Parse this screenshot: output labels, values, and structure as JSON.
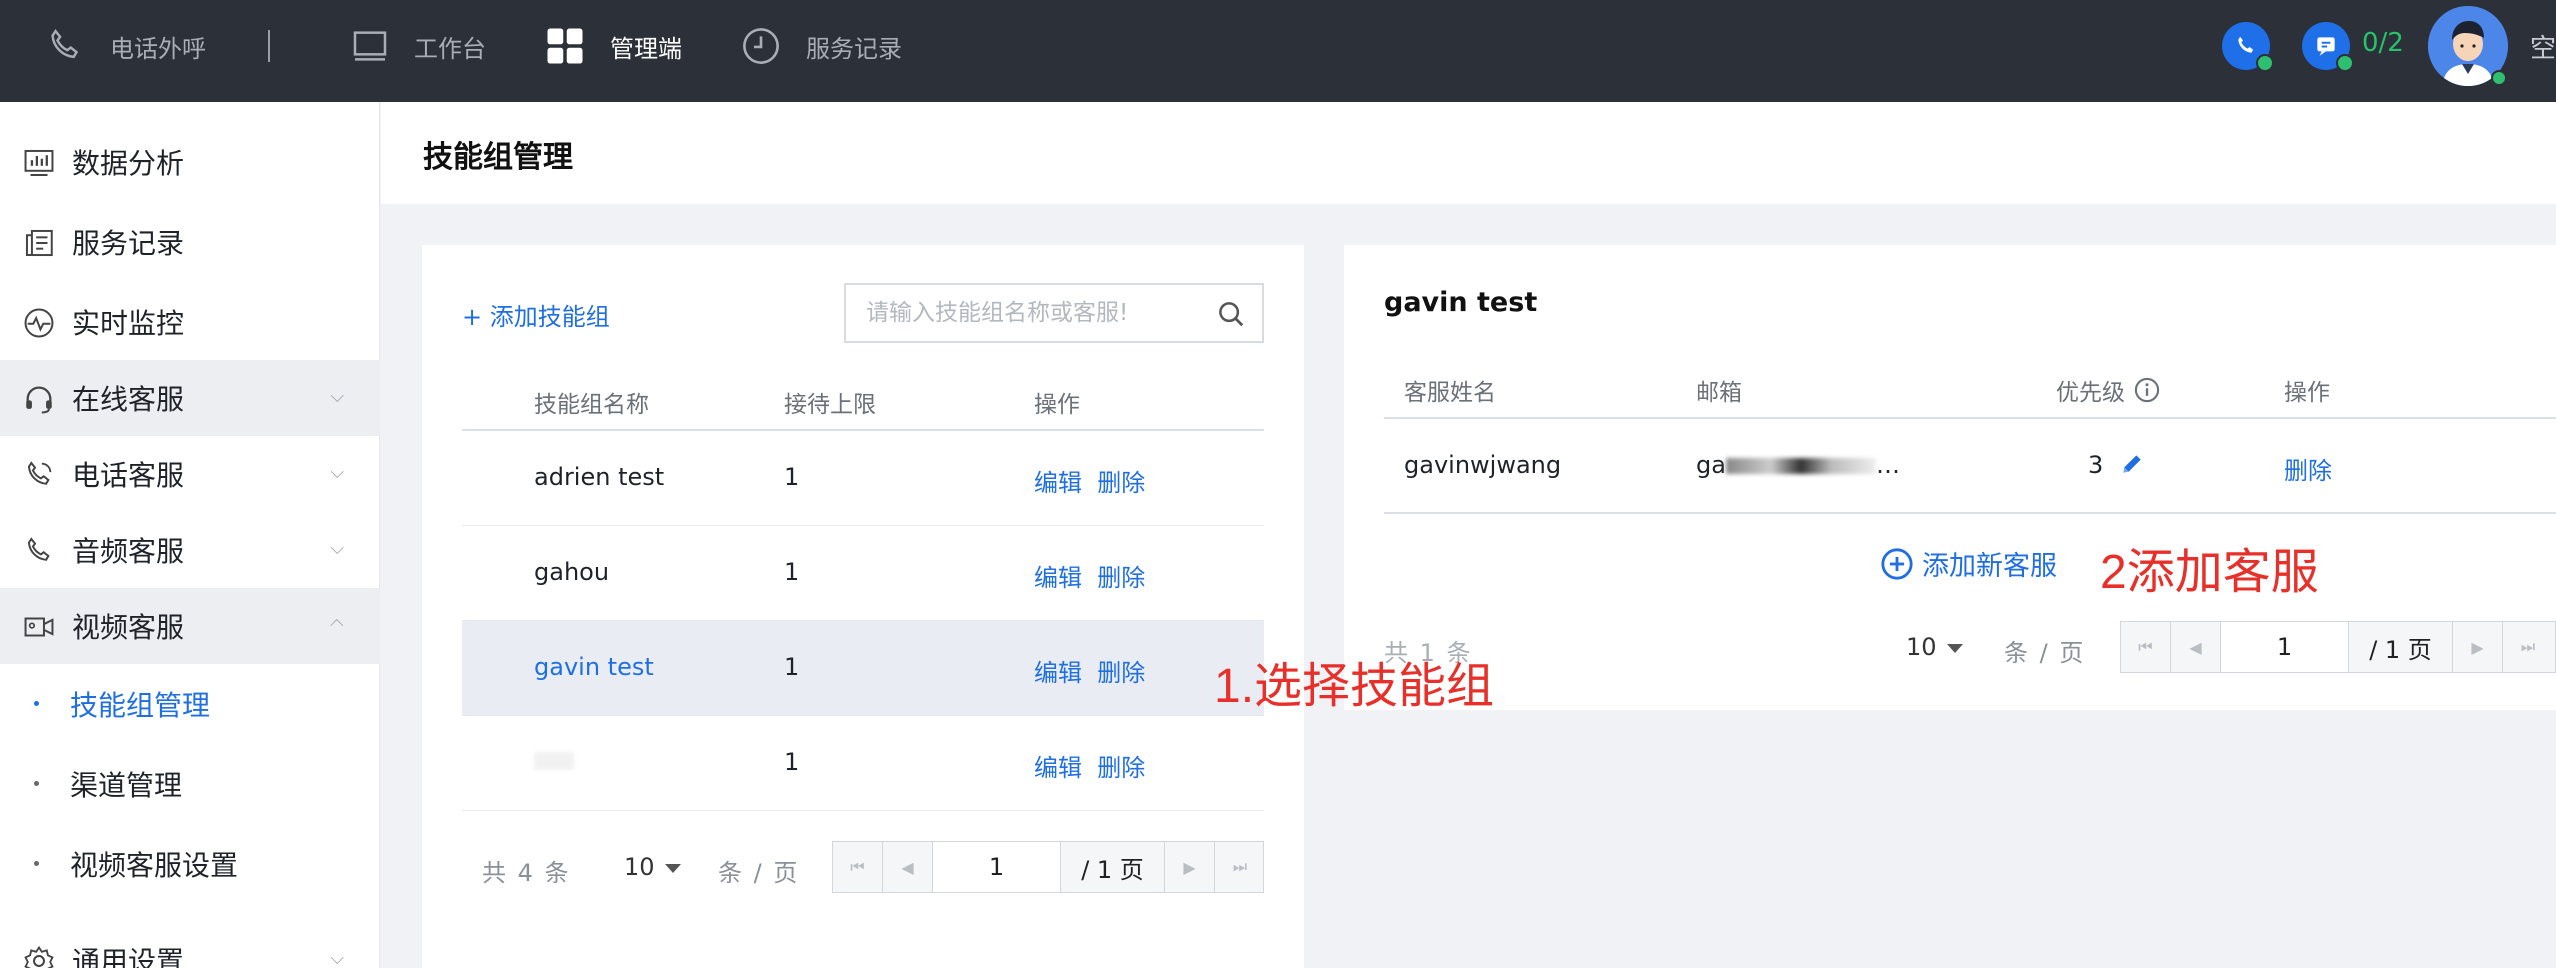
{
  "topbar": {
    "phone_label": "电话外呼",
    "workbench_label": "工作台",
    "admin_label": "管理端",
    "records_label": "服务记录",
    "session_count": "0/2",
    "user_name": "空"
  },
  "sidebar": {
    "items": [
      {
        "label": "数据分析",
        "icon": "chart-icon"
      },
      {
        "label": "服务记录",
        "icon": "records-icon"
      },
      {
        "label": "实时监控",
        "icon": "monitor-icon"
      },
      {
        "label": "在线客服",
        "icon": "headset-icon"
      },
      {
        "label": "电话客服",
        "icon": "phone-icon"
      },
      {
        "label": "音频客服",
        "icon": "audio-icon"
      },
      {
        "label": "视频客服",
        "icon": "video-icon"
      }
    ],
    "sub_items": [
      {
        "label": "技能组管理"
      },
      {
        "label": "渠道管理"
      },
      {
        "label": "视频客服设置"
      }
    ],
    "bottom_label": "通用设置"
  },
  "page": {
    "title": "技能组管理"
  },
  "skill_groups": {
    "add_label": "+ 添加技能组",
    "search_placeholder": "请输入技能组名称或客服!",
    "columns": [
      "技能组名称",
      "接待上限",
      "操作"
    ],
    "rows": [
      {
        "name": "adrien test",
        "limit": "1",
        "edit": "编辑",
        "delete": "删除"
      },
      {
        "name": "gahou",
        "limit": "1",
        "edit": "编辑",
        "delete": "删除"
      },
      {
        "name": "gavin test",
        "limit": "1",
        "edit": "编辑",
        "delete": "删除"
      },
      {
        "name": "",
        "limit": "1",
        "edit": "编辑",
        "delete": "删除"
      }
    ],
    "pager": {
      "total": "共 4 条",
      "page_size": "10",
      "per_page": "条 / 页",
      "current": "1",
      "pages": "/ 1 页"
    }
  },
  "group_detail": {
    "title": "gavin test",
    "columns": [
      "客服姓名",
      "邮箱",
      "优先级",
      "操作"
    ],
    "rows": [
      {
        "name": "gavinwjwang",
        "email_visible": "ga",
        "email_tail": "…",
        "priority": "3",
        "delete": "删除"
      }
    ],
    "add_label": "添加新客服",
    "pager": {
      "total": "共 1 条",
      "page_size": "10",
      "per_page": "条 / 页",
      "current": "1",
      "pages": "/ 1 页"
    }
  },
  "annotations": {
    "step1": "1.选择技能组",
    "step2": "2添加客服"
  },
  "colors": {
    "topbar": "#2c3039",
    "accent": "#1f6fe3",
    "annotation": "#e8302a",
    "online": "#2fbf71"
  }
}
